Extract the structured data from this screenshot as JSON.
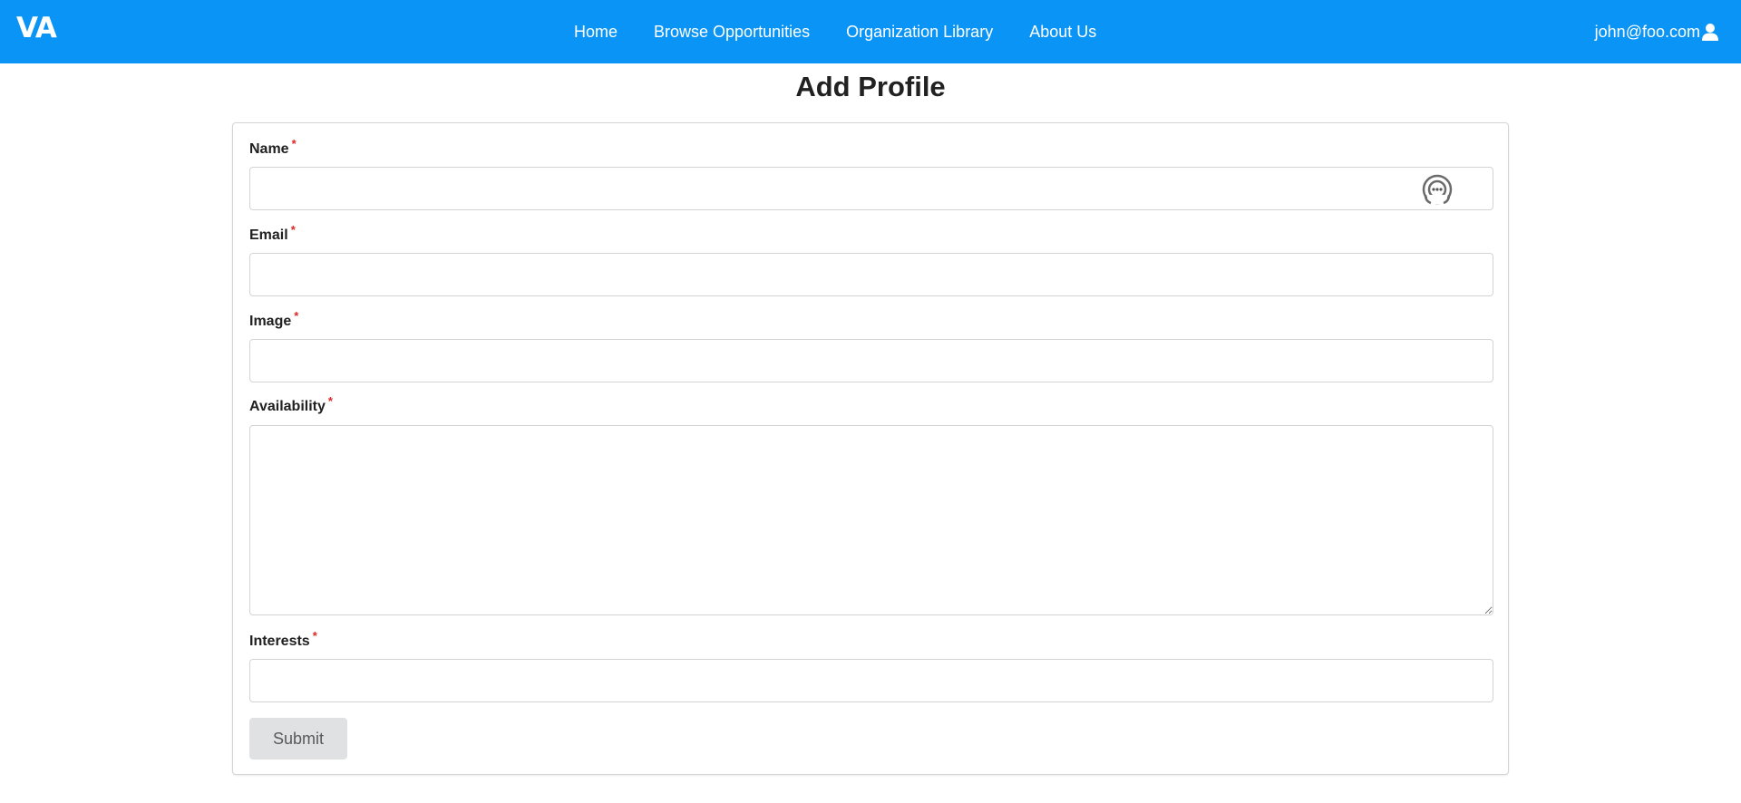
{
  "navbar": {
    "brand": "VA",
    "links": [
      {
        "label": "Home"
      },
      {
        "label": "Browse Opportunities"
      },
      {
        "label": "Organization Library"
      },
      {
        "label": "About Us"
      }
    ],
    "user_email": "john@foo.com",
    "user_icon": "user-icon",
    "background_color": "#0a94f5"
  },
  "page": {
    "title": "Add Profile"
  },
  "form": {
    "required_marker": "*",
    "fields": {
      "name": {
        "label": "Name",
        "value": ""
      },
      "email": {
        "label": "Email",
        "value": ""
      },
      "image": {
        "label": "Image",
        "value": ""
      },
      "availability": {
        "label": "Availability",
        "value": ""
      },
      "interests": {
        "label": "Interests",
        "value": ""
      }
    },
    "assist_icon": "chat-bubble-icon",
    "submit_label": "Submit"
  }
}
